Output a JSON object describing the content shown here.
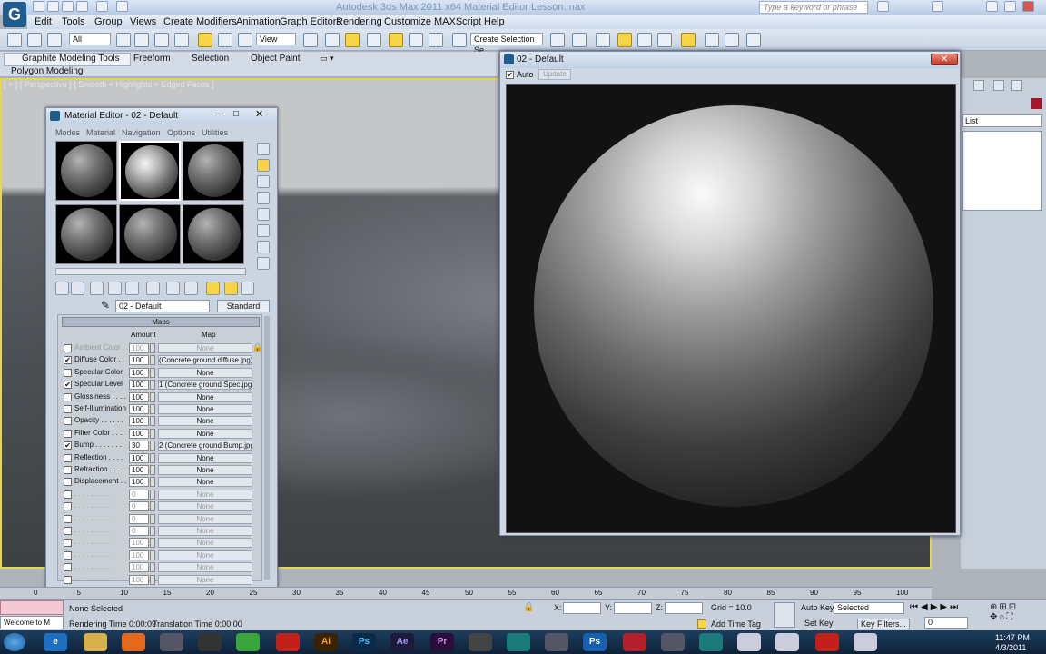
{
  "app": {
    "window_title": "Autodesk 3ds Max 2011 x64    Material Editor Lesson.max",
    "search_placeholder": "Type a keyword or phrase"
  },
  "menu": [
    "Edit",
    "Tools",
    "Group",
    "Views",
    "Create",
    "Modifiers",
    "Animation",
    "Graph Editors",
    "Rendering",
    "Customize",
    "MAXScript",
    "Help"
  ],
  "toolbar": {
    "selection_filter": "All",
    "ref_coord": "View",
    "named_selection": "Create Selection Se"
  },
  "ribbon": {
    "tabs": [
      "Graphite Modeling Tools",
      "Freeform",
      "Selection",
      "Object Paint"
    ],
    "subtab": "Polygon Modeling"
  },
  "viewport": {
    "label": "[ + ] [ Perspective ] [ Smooth + Highlights + Edged Faces ]"
  },
  "cmd_panel": {
    "list_label": "List"
  },
  "material_editor": {
    "title": "Material Editor - 02 - Default",
    "menus": [
      "Modes",
      "Material",
      "Navigation",
      "Options",
      "Utilities"
    ],
    "material_name": "02 - Default",
    "material_type": "Standard",
    "maps_header": "Maps",
    "col_amount": "Amount",
    "col_map": "Map",
    "rows": [
      {
        "label": "Ambient Color . .",
        "checked": "",
        "amount": "100",
        "map": "None",
        "dim": true
      },
      {
        "label": "Diffuse Color . .",
        "checked": "✔",
        "amount": "100",
        "map": "(Concrete ground diffuse.jpg)",
        "dim": false
      },
      {
        "label": "Specular Color",
        "checked": "",
        "amount": "100",
        "map": "None",
        "dim": false
      },
      {
        "label": "Specular Level",
        "checked": "✔",
        "amount": "100",
        "map": "1 (Concrete ground Spec.jpg)",
        "dim": false
      },
      {
        "label": "Glossiness . . . .",
        "checked": "",
        "amount": "100",
        "map": "None",
        "dim": false
      },
      {
        "label": "Self-Illumination",
        "checked": "",
        "amount": "100",
        "map": "None",
        "dim": false
      },
      {
        "label": "Opacity . . . . . .",
        "checked": "",
        "amount": "100",
        "map": "None",
        "dim": false
      },
      {
        "label": "Filter Color . . .",
        "checked": "",
        "amount": "100",
        "map": "None",
        "dim": false
      },
      {
        "label": "Bump . . . . . . .",
        "checked": "✔",
        "amount": "30",
        "map": "2 (Concrete ground Bump.jpg)",
        "dim": false
      },
      {
        "label": "Reflection . . . .",
        "checked": "",
        "amount": "100",
        "map": "None",
        "dim": false
      },
      {
        "label": "Refraction . . . .",
        "checked": "",
        "amount": "100",
        "map": "None",
        "dim": false
      },
      {
        "label": "Displacement . .",
        "checked": "",
        "amount": "100",
        "map": "None",
        "dim": false
      },
      {
        "label": ". . . . . . . . . .",
        "checked": "",
        "amount": "0",
        "map": "None",
        "dim": true
      },
      {
        "label": ". . . . . . . . . .",
        "checked": "",
        "amount": "0",
        "map": "None",
        "dim": true
      },
      {
        "label": ". . . . . . . . . .",
        "checked": "",
        "amount": "0",
        "map": "None",
        "dim": true
      },
      {
        "label": ". . . . . . . . . .",
        "checked": "",
        "amount": "0",
        "map": "None",
        "dim": true
      },
      {
        "label": ". . . . . . . . . .",
        "checked": "",
        "amount": "100",
        "map": "None",
        "dim": true
      },
      {
        "label": ". . . . . . . . . .",
        "checked": "",
        "amount": "100",
        "map": "None",
        "dim": true
      },
      {
        "label": ". . . . . . . . . .",
        "checked": "",
        "amount": "100",
        "map": "None",
        "dim": true
      },
      {
        "label": ". . . . . . . . . .",
        "checked": "",
        "amount": "100",
        "map": "None",
        "dim": true
      }
    ]
  },
  "render_window": {
    "title": "02 - Default",
    "auto_label": "Auto",
    "update_label": "Update"
  },
  "timeline": {
    "ticks": [
      "0",
      "5",
      "10",
      "15",
      "20",
      "25",
      "30",
      "35",
      "40",
      "45",
      "50",
      "55",
      "60",
      "65",
      "70",
      "75",
      "80",
      "85",
      "90",
      "95",
      "100"
    ]
  },
  "status": {
    "none_selected": "None Selected",
    "welcome": "Welcome to M",
    "rendering_time": "Rendering Time  0:00:09",
    "translation_time": "Translation Time  0:00:00",
    "x_label": "X:",
    "y_label": "Y:",
    "z_label": "Z:",
    "grid": "Grid = 10.0",
    "add_time_tag": "Add Time Tag",
    "auto_key": "Auto Key",
    "set_key": "Set Key",
    "selected": "Selected",
    "key_filters": "Key Filters...",
    "frame": "0"
  },
  "taskbar": {
    "apps": [
      "Ai",
      "Ps",
      "Ae",
      "Pr",
      "Ps"
    ],
    "time": "11:47 PM",
    "date": "4/3/2011"
  }
}
